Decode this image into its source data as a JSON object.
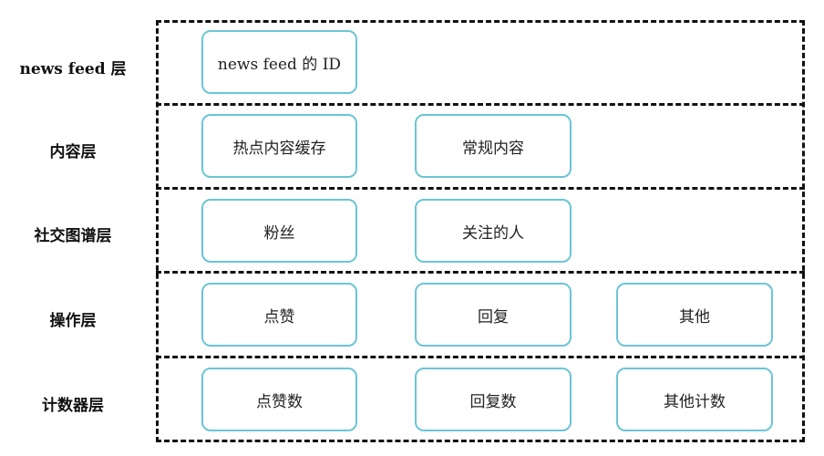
{
  "layers": [
    {
      "label": "news feed 层",
      "nodes": [
        "news feed 的 ID"
      ]
    },
    {
      "label": "内容层",
      "nodes": [
        "热点内容缓存",
        "常规内容"
      ]
    },
    {
      "label": "社交图谱层",
      "nodes": [
        "粉丝",
        "关注的人"
      ]
    },
    {
      "label": "操作层",
      "nodes": [
        "点赞",
        "回复",
        "其他"
      ]
    },
    {
      "label": "计数器层",
      "nodes": [
        "点赞数",
        "回复数",
        "其他计数"
      ]
    }
  ],
  "colors": {
    "node_border": "#6cc4d8",
    "dash": "#111111"
  }
}
